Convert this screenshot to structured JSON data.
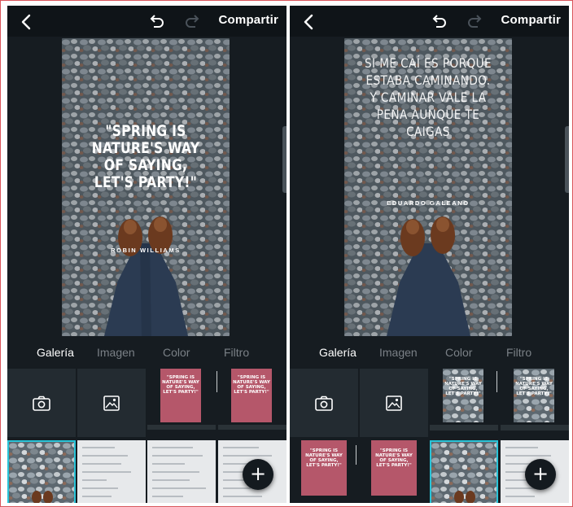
{
  "toolbar": {
    "share_label": "Compartir"
  },
  "tabs": [
    "Galería",
    "Imagen",
    "Color",
    "Filtro"
  ],
  "left": {
    "quote": "\"SPRING IS NATURE'S WAY OF SAYING, LET'S PARTY!\"",
    "author": "ROBIN WILLIAMS"
  },
  "right": {
    "quote": "SI ME CAÍ ES PORQUE ESTABA CAMINANDO. Y CAMINAR VALE LA PENA AUNQUE TE CAIGAS",
    "author": "EDUARDO GALEANO"
  },
  "thumbs": {
    "spring_caption": "\"SPRING IS NATURE'S WAY OF SAYING, LET'S PARTY!\""
  },
  "icons": [
    "back-arrow-icon",
    "undo-icon",
    "redo-icon",
    "camera-icon",
    "image-icon",
    "plus-icon"
  ],
  "colors": {
    "panel": "#161c21",
    "accent": "#29c4d8",
    "frame": "#d9545b"
  }
}
